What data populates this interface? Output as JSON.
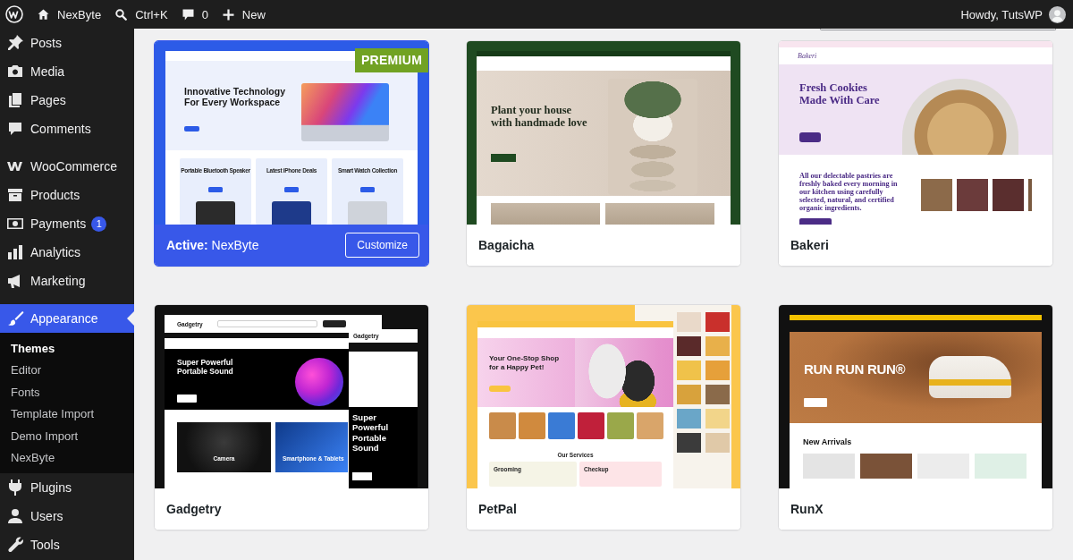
{
  "admin_bar": {
    "site_name": "NexByte",
    "search_shortcut": "Ctrl+K",
    "comments_count": "0",
    "new_label": "New",
    "greeting": "Howdy, TutsWP"
  },
  "sidebar": {
    "groups": [
      {
        "items": [
          {
            "label": "Posts",
            "selected": false
          },
          {
            "label": "Media",
            "selected": false
          },
          {
            "label": "Pages",
            "selected": false
          },
          {
            "label": "Comments",
            "selected": false
          }
        ]
      },
      {
        "items": [
          {
            "label": "WooCommerce",
            "selected": false
          },
          {
            "label": "Products",
            "selected": false
          },
          {
            "label": "Payments",
            "selected": false,
            "badge": "1"
          },
          {
            "label": "Analytics",
            "selected": false
          },
          {
            "label": "Marketing",
            "selected": false
          }
        ]
      },
      {
        "items": [
          {
            "label": "Appearance",
            "selected": true,
            "expanded": true,
            "children": [
              {
                "label": "Themes",
                "selected": true
              },
              {
                "label": "Editor",
                "selected": false
              },
              {
                "label": "Fonts",
                "selected": false
              },
              {
                "label": "Template Import",
                "selected": false
              },
              {
                "label": "Demo Import",
                "selected": false
              },
              {
                "label": "NexByte",
                "selected": false
              }
            ]
          },
          {
            "label": "Plugins",
            "selected": false
          },
          {
            "label": "Users",
            "selected": false
          },
          {
            "label": "Tools",
            "selected": false
          }
        ]
      }
    ]
  },
  "themes": [
    {
      "name": "NexByte",
      "active": true,
      "active_label": "Active:",
      "badge": "PREMIUM",
      "action": "Customize",
      "preview": {
        "kind": "electronics",
        "headline": "Innovative Technology For Every Workspace",
        "cards": [
          "Portable Bluetooth Speaker",
          "Latest iPhone Deals",
          "Smart Watch Collection"
        ]
      }
    },
    {
      "name": "Bagaicha",
      "active": false,
      "preview": {
        "kind": "plants",
        "headline": "Plant your house with handmade love"
      }
    },
    {
      "name": "Bakeri",
      "active": false,
      "preview": {
        "kind": "bakery",
        "logo": "Bakeri",
        "headline": "Fresh Cookies Made With Care",
        "intro": "All our delectable pastries are freshly baked every morning in our kitchen using carefully selected, natural, and certified organic ingredients."
      }
    },
    {
      "name": "Gadgetry",
      "active": false,
      "preview": {
        "kind": "gadgets",
        "logo": "Gadgetry",
        "headline": "Super Powerful Portable Sound",
        "categories": [
          "Camera",
          "Smartphone & Tablets"
        ],
        "mobile_logo": "Gadgetry",
        "mobile_headline": "Super Powerful Portable Sound"
      }
    },
    {
      "name": "PetPal",
      "active": false,
      "preview": {
        "kind": "pets",
        "headline": "Your One-Stop Shop for a Happy Pet!",
        "section_title": "Our Services",
        "services": [
          "Grooming",
          "Checkup"
        ]
      }
    },
    {
      "name": "RunX",
      "active": false,
      "preview": {
        "kind": "sneakers",
        "headline": "RUN RUN RUN®",
        "section_title": "New Arrivals"
      }
    }
  ]
}
